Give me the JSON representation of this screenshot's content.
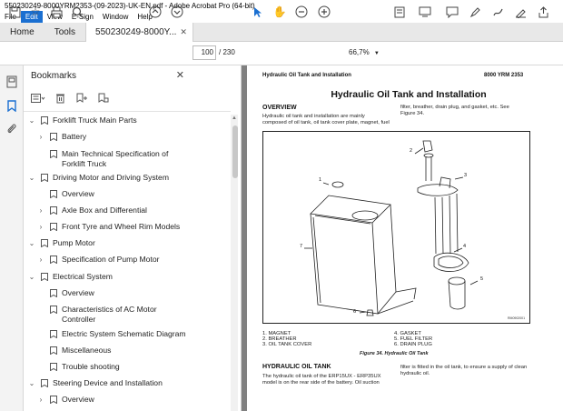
{
  "window": {
    "title": "550230249-8000YRM2353-(09-2023)-UK-EN.pdf - Adobe Acrobat Pro (64-bit)"
  },
  "menu": {
    "items": [
      "File",
      "Edit",
      "View",
      "E-Sign",
      "Window",
      "Help"
    ]
  },
  "tabs": {
    "home": "Home",
    "tools": "Tools",
    "document": "550230249-8000Y..."
  },
  "toolbar": {
    "page_current": "100",
    "page_total": "/ 230",
    "zoom": "66,7%"
  },
  "bookmarks": {
    "title": "Bookmarks",
    "items": [
      {
        "label": "Forklift Truck Main Parts",
        "level": 0,
        "state": "expanded"
      },
      {
        "label": "Battery",
        "level": 1,
        "state": "collapsed"
      },
      {
        "label": "Main Technical Specification of Forklift Truck",
        "level": 1,
        "state": "leaf"
      },
      {
        "label": "Driving Motor and Driving System",
        "level": 0,
        "state": "expanded"
      },
      {
        "label": "Overview",
        "level": 1,
        "state": "leaf"
      },
      {
        "label": "Axle Box and Differential",
        "level": 1,
        "state": "collapsed"
      },
      {
        "label": "Front Tyre and Wheel Rim Models",
        "level": 1,
        "state": "collapsed"
      },
      {
        "label": "Pump Motor",
        "level": 0,
        "state": "expanded"
      },
      {
        "label": "Specification of Pump Motor",
        "level": 1,
        "state": "collapsed"
      },
      {
        "label": "Electrical System",
        "level": 0,
        "state": "expanded"
      },
      {
        "label": "Overview",
        "level": 1,
        "state": "leaf"
      },
      {
        "label": "Characteristics of AC Motor Controller",
        "level": 1,
        "state": "leaf"
      },
      {
        "label": "Electric System Schematic Diagram",
        "level": 1,
        "state": "leaf"
      },
      {
        "label": "Miscellaneous",
        "level": 1,
        "state": "leaf"
      },
      {
        "label": "Trouble shooting",
        "level": 1,
        "state": "leaf"
      },
      {
        "label": "Steering Device and Installation",
        "level": 0,
        "state": "expanded"
      },
      {
        "label": "Overview",
        "level": 1,
        "state": "collapsed"
      }
    ]
  },
  "document": {
    "header_left": "Hydraulic Oil Tank and Installation",
    "header_right": "8000 YRM 2353",
    "title": "Hydraulic Oil Tank and Installation",
    "overview_heading": "OVERVIEW",
    "overview_col1_line1": "Hydraulic oil tank and installation are mainly",
    "overview_col1_line2": "composed of oil tank, oil tank cover plate, magnet, fuel",
    "overview_col2_line1": "filter, breather, drain plug, and gasket, etc. See",
    "overview_col2_line2": "Figure 34.",
    "callouts": [
      "1",
      "2",
      "3",
      "4",
      "5",
      "6",
      "7"
    ],
    "figure_code": "RM0902001",
    "legend_left": [
      "1.   MAGNET",
      "2.   BREATHER",
      "3.   OIL TANK COVER"
    ],
    "legend_right": [
      "4.   GASKET",
      "5.   FUEL FILTER",
      "6.   DRAIN PLUG"
    ],
    "caption": "Figure 34. Hydraulic Oil Tank",
    "tank_heading": "HYDRAULIC OIL TANK",
    "tank_col1_line1": "The hydraulic oil tank of the ERP15UX - ERP35UX",
    "tank_col1_line2": "model is on the rear side of the battery. Oil suction",
    "tank_col2_line1": "filter is fitted in the oil tank, to ensure a supply of clean",
    "tank_col2_line2": "hydraulic oil."
  }
}
